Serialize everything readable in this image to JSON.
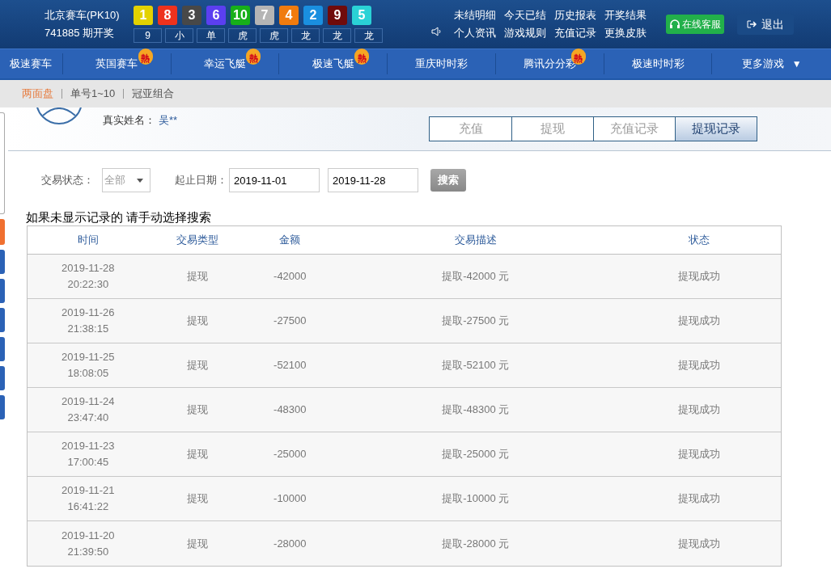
{
  "header": {
    "game": "北京赛车(PK10)",
    "draw": "741885 期开奖",
    "balls": [
      {
        "number": "1",
        "color": "#e3d200"
      },
      {
        "number": "8",
        "color": "#ee321d"
      },
      {
        "number": "3",
        "color": "#484848"
      },
      {
        "number": "6",
        "color": "#5b3ff0"
      },
      {
        "number": "10",
        "color": "#17b019"
      },
      {
        "number": "7",
        "color": "#b5b5b5"
      },
      {
        "number": "4",
        "color": "#f07b0e"
      },
      {
        "number": "2",
        "color": "#1a8fdf"
      },
      {
        "number": "9",
        "color": "#700b0b"
      },
      {
        "number": "5",
        "color": "#2ad2d6"
      }
    ],
    "results": [
      "9",
      "小",
      "单",
      "虎",
      "虎",
      "龙",
      "龙",
      "龙"
    ],
    "links": [
      "未结明细",
      "今天已结",
      "历史报表",
      "开奖结果",
      "个人资讯",
      "游戏规则",
      "充值记录",
      "更换皮肤"
    ],
    "service_button": "在线客服",
    "logout_button": "退出"
  },
  "nav": [
    {
      "label": "极速赛车"
    },
    {
      "label": "英国赛车",
      "badge": "熱"
    },
    {
      "label": "幸运飞艇",
      "badge": "熱"
    },
    {
      "label": "极速飞艇",
      "badge": "熱"
    },
    {
      "label": "重庆时时彩"
    },
    {
      "label": "腾讯分分彩",
      "badge": "熱"
    },
    {
      "label": "极速时时彩"
    },
    {
      "label": "更多游戏",
      "dropdown": "▼"
    }
  ],
  "subnav": [
    {
      "label": "两面盘",
      "selected": true
    },
    {
      "label": "单号1~10",
      "selected": false
    },
    {
      "label": "冠亚组合",
      "selected": false
    }
  ],
  "side_tabs": [
    {
      "selected": false
    },
    {
      "selected": true
    },
    {
      "selected": false
    },
    {
      "selected": false
    },
    {
      "selected": false
    },
    {
      "selected": false
    },
    {
      "selected": false
    },
    {
      "selected": false
    }
  ],
  "profile": {
    "name_label": "真实姓名：",
    "name_value": "吴**"
  },
  "tabs": [
    {
      "label": "充值",
      "selected": false
    },
    {
      "label": "提现",
      "selected": false
    },
    {
      "label": "充值记录",
      "selected": false
    },
    {
      "label": "提现记录",
      "selected": true
    }
  ],
  "filter": {
    "status_label": "交易状态：",
    "status_value": "全部",
    "date_label": "起止日期：",
    "date_from": "2019-11-01",
    "date_to": "2019-11-28",
    "search_button": "搜索"
  },
  "hint": "如果未显示记录的 请手动选择搜索",
  "table": {
    "columns": [
      "时间",
      "交易类型",
      "金额",
      "交易描述",
      "状态"
    ],
    "rows": [
      [
        "2019-11-28 20:22:30",
        "提现",
        "-42000",
        "提取-42000 元",
        "提现成功"
      ],
      [
        "2019-11-26 21:38:15",
        "提现",
        "-27500",
        "提取-27500 元",
        "提现成功"
      ],
      [
        "2019-11-25 18:08:05",
        "提现",
        "-52100",
        "提取-52100 元",
        "提现成功"
      ],
      [
        "2019-11-24 23:47:40",
        "提现",
        "-48300",
        "提取-48300 元",
        "提现成功"
      ],
      [
        "2019-11-23 17:00:45",
        "提现",
        "-25000",
        "提取-25000 元",
        "提现成功"
      ],
      [
        "2019-11-21 16:41:22",
        "提现",
        "-10000",
        "提取-10000 元",
        "提现成功"
      ],
      [
        "2019-11-20 21:39:50",
        "提现",
        "-28000",
        "提取-28000 元",
        "提现成功"
      ]
    ]
  }
}
